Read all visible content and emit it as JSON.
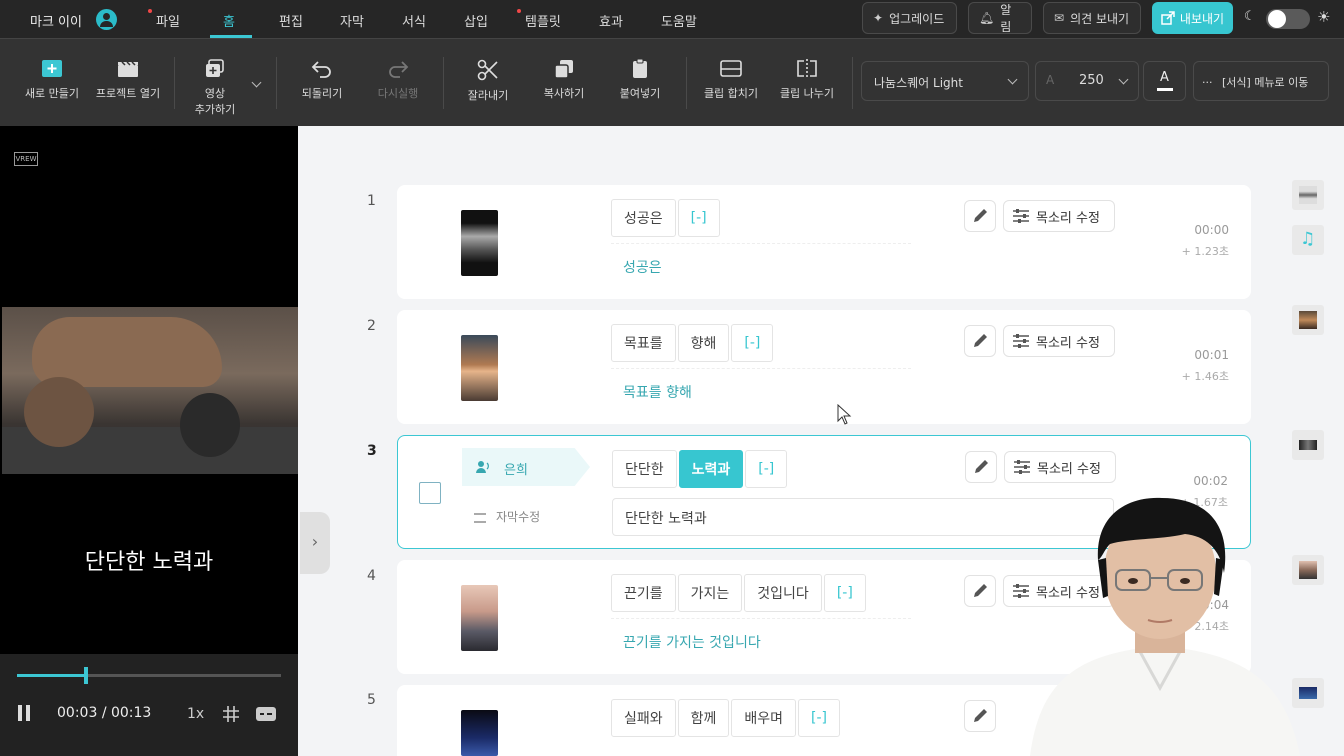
{
  "app": {
    "name": "마크 이이"
  },
  "menu": {
    "items": [
      {
        "label": "파일",
        "dot": true
      },
      {
        "label": "홈",
        "active": true
      },
      {
        "label": "편집"
      },
      {
        "label": "자막"
      },
      {
        "label": "서식"
      },
      {
        "label": "삽입"
      },
      {
        "label": "템플릿",
        "dot": true
      },
      {
        "label": "효과"
      },
      {
        "label": "도움말"
      }
    ],
    "upgrade": "업그레이드",
    "alarm": "알림",
    "feedback": "의견 보내기",
    "export": "내보내기"
  },
  "toolbar": {
    "new": "새로 만들기",
    "open": "프로젝트 열기",
    "add_video_1": "영상",
    "add_video_2": "추가하기",
    "undo": "되돌리기",
    "redo": "다시실행",
    "cut": "잘라내기",
    "copy": "복사하기",
    "paste": "붙여넣기",
    "merge": "클립 합치기",
    "split": "클립 나누기",
    "font": "나눔스퀘어 Light",
    "size": "250",
    "color_letter": "A",
    "format_menu": "[서식] 메뉴로 이동"
  },
  "preview": {
    "subtitle": "단단한 노력과",
    "current_time": "00:03",
    "total_time": "/ 00:13",
    "speed": "1x",
    "progress": 0.26
  },
  "clips": [
    {
      "num": "1",
      "words": [
        "성공은"
      ],
      "bracket": "[-]",
      "caption": "성공은",
      "time": "00:00",
      "duration": "+ 1.23초"
    },
    {
      "num": "2",
      "words": [
        "목표를",
        "향해"
      ],
      "bracket": "[-]",
      "caption": "목표를 향해",
      "time": "00:01",
      "duration": "+ 1.46초"
    },
    {
      "num": "3",
      "speaker": "은희",
      "edit_caption": "자막수정",
      "words": [
        "단단한",
        "노력과"
      ],
      "highlight": "노력과",
      "bracket": "[-]",
      "caption": "단단한 노력과",
      "time": "00:02",
      "duration": "+ 1.67초"
    },
    {
      "num": "4",
      "words": [
        "끈기를",
        "가지는",
        "것입니다"
      ],
      "bracket": "[-]",
      "caption": "끈기를 가지는 것입니다",
      "time": "00:04",
      "duration": "2.14초"
    },
    {
      "num": "5",
      "words": [
        "실패와",
        "함께",
        "배우며"
      ],
      "bracket": "[-]"
    }
  ],
  "voice_edit": "목소리 수정",
  "colors": {
    "accent": "#37c6d0",
    "topbar": "#262626",
    "toolbar": "#333333"
  }
}
